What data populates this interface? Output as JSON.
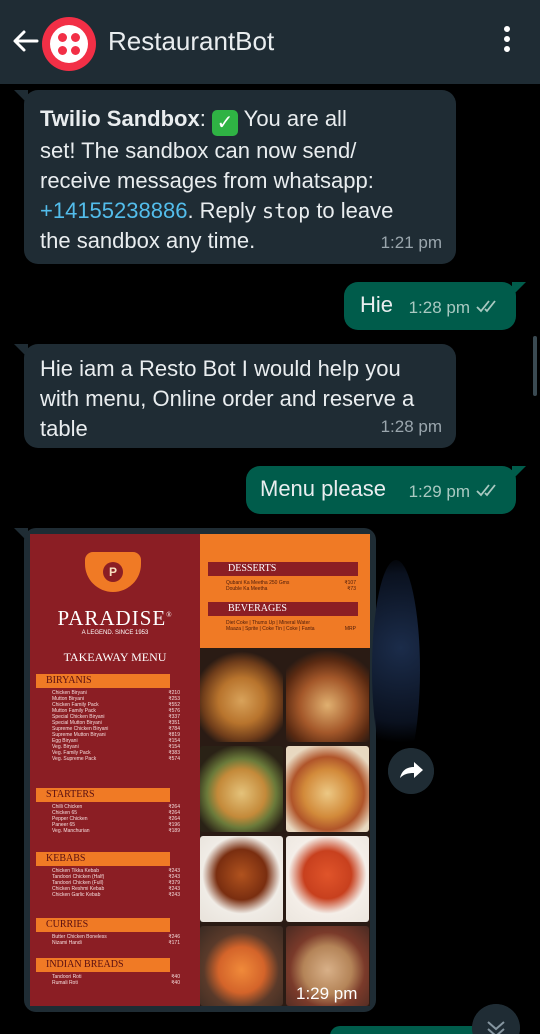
{
  "header": {
    "title": "RestaurantBot",
    "colors": {
      "bar": "#1f2c34",
      "avatar": "#f22f46"
    }
  },
  "messages": [
    {
      "direction": "in",
      "sender": "Twilio Sandbox",
      "text_1": "You are all",
      "text_2": "set! The sandbox can now send/",
      "text_3": "receive messages from whatsapp:",
      "phone": "+14155238886",
      "text_4": ". Reply ",
      "keyword": "stop",
      "text_5": " to leave",
      "text_6": "the sandbox any time.",
      "time": "1:21 pm"
    },
    {
      "direction": "out",
      "text": "Hie",
      "time": "1:28 pm",
      "status": "read"
    },
    {
      "direction": "in",
      "line_1": "Hie iam a Resto Bot I would help you",
      "line_2": "with menu, Online order and reserve a",
      "line_3": "table",
      "time": "1:28 pm"
    },
    {
      "direction": "out",
      "text": "Menu please",
      "time": "1:29 pm",
      "status": "read"
    },
    {
      "direction": "in",
      "type": "image",
      "time": "1:29 pm",
      "menu": {
        "brand": "PARADISE",
        "reg": "®",
        "tagline": "A LEGEND. SINCE 1953",
        "heading": "TAKEAWAY MENU",
        "sections": {
          "biryanis": "BIRYANIS",
          "starters": "STARTERS",
          "kebabs": "KEBABS",
          "curries": "CURRIES",
          "breads": "INDIAN BREADS",
          "desserts": "DESSERTS",
          "beverages": "BEVERAGES"
        },
        "biryani_items": [
          [
            "Chicken Biryani",
            "₹210"
          ],
          [
            "Mutton Biryani",
            "₹253"
          ],
          [
            "Chicken Family Pack",
            "₹552"
          ],
          [
            "Mutton Family Pack",
            "₹576"
          ],
          [
            "Special Chicken Biryani",
            "₹337"
          ],
          [
            "Special Mutton Biryani",
            "₹351"
          ],
          [
            "Supreme Chicken Biryani",
            "₹784"
          ],
          [
            "Supreme Mutton Biryani",
            "₹819"
          ],
          [
            "Egg Biryani",
            "₹154"
          ],
          [
            "Veg. Biryani",
            "₹154"
          ],
          [
            "Veg. Family Pack",
            "₹383"
          ],
          [
            "Veg. Supreme Pack",
            "₹574"
          ]
        ],
        "starter_items": [
          [
            "Chilli Chicken",
            "₹264"
          ],
          [
            "Chicken 65",
            "₹264"
          ],
          [
            "Pepper Chicken",
            "₹264"
          ],
          [
            "Paneer 65",
            "₹196"
          ],
          [
            "Veg. Manchurian",
            "₹189"
          ]
        ],
        "kebab_items": [
          [
            "Chicken Tikka Kebab",
            "₹243"
          ],
          [
            "Tandoori Chicken (Half)",
            "₹243"
          ],
          [
            "Tandoori Chicken (Full)",
            "₹379"
          ],
          [
            "Chicken Reshmi Kebab",
            "₹243"
          ],
          [
            "Chicken Garlic Kebab",
            "₹243"
          ]
        ],
        "curry_items": [
          [
            "Butter Chicken Boneless",
            "₹246"
          ],
          [
            "Nizami Handi",
            "₹171"
          ]
        ],
        "bread_items": [
          [
            "Tandoori Roti",
            "₹40"
          ],
          [
            "Rumali Roti",
            "₹40"
          ]
        ],
        "dessert_items": [
          [
            "Qubani Ka Meetha 250 Gms",
            "₹107"
          ],
          [
            "Double Ka Meetha",
            "₹73"
          ]
        ],
        "beverage_line_1": "Diet Coke | Thums Up | Mineral Water",
        "beverage_line_2": "Maaza | Sprite | Coke Tin | Coke | Fanta",
        "beverage_price": "MRP"
      }
    }
  ],
  "icons": {
    "back": "arrow-left-icon",
    "menu": "more-vertical-icon",
    "forward": "share-forward-icon",
    "scroll_down": "chevron-double-down-icon",
    "read": "double-check-icon",
    "check_emoji": "white-check-mark-emoji"
  }
}
